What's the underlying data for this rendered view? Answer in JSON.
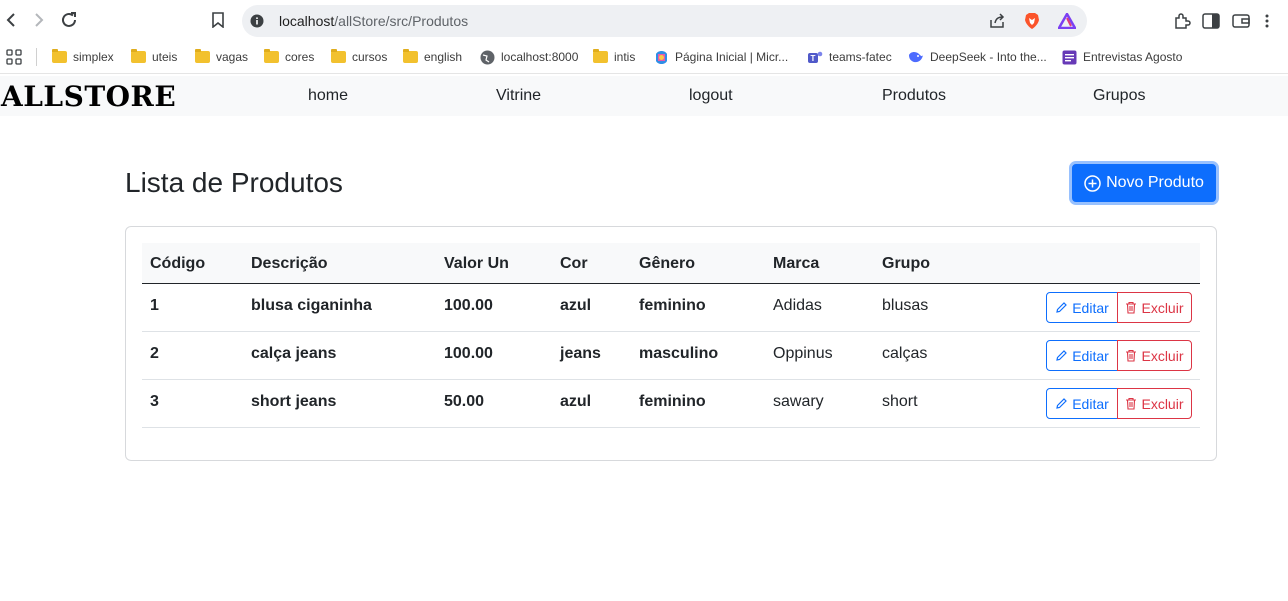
{
  "browser": {
    "url_host": "localhost",
    "url_path": "/allStore/src/Produtos",
    "bookmarks": [
      "simplex",
      "uteis",
      "vagas",
      "cores",
      "cursos",
      "english",
      "localhost:8000",
      "intis",
      "Página Inicial | Micr...",
      "teams-fatec",
      "DeepSeek - Into the...",
      "Entrevistas Agosto"
    ]
  },
  "app": {
    "brand": "ALLSTORE",
    "nav": [
      "home",
      "Vitrine",
      "logout",
      "Produtos",
      "Grupos"
    ]
  },
  "page": {
    "title": "Lista de Produtos",
    "new_button": "Novo Produto"
  },
  "table": {
    "headers": [
      "Código",
      "Descrição",
      "Valor Un",
      "Cor",
      "Gênero",
      "Marca",
      "Grupo"
    ],
    "rows": [
      [
        "1",
        "blusa ciganinha",
        "100.00",
        "azul",
        "feminino",
        "Adidas",
        "blusas"
      ],
      [
        "2",
        "calça jeans",
        "100.00",
        "jeans",
        "masculino",
        "Oppinus",
        "calças"
      ],
      [
        "3",
        "short jeans",
        "50.00",
        "azul",
        "feminino",
        "sawary",
        "short"
      ]
    ],
    "edit_label": "Editar",
    "delete_label": "Excluir"
  },
  "colors": {
    "primary": "#0d6efd",
    "danger": "#dc3545",
    "navbar_bg": "#f8f9fa"
  }
}
